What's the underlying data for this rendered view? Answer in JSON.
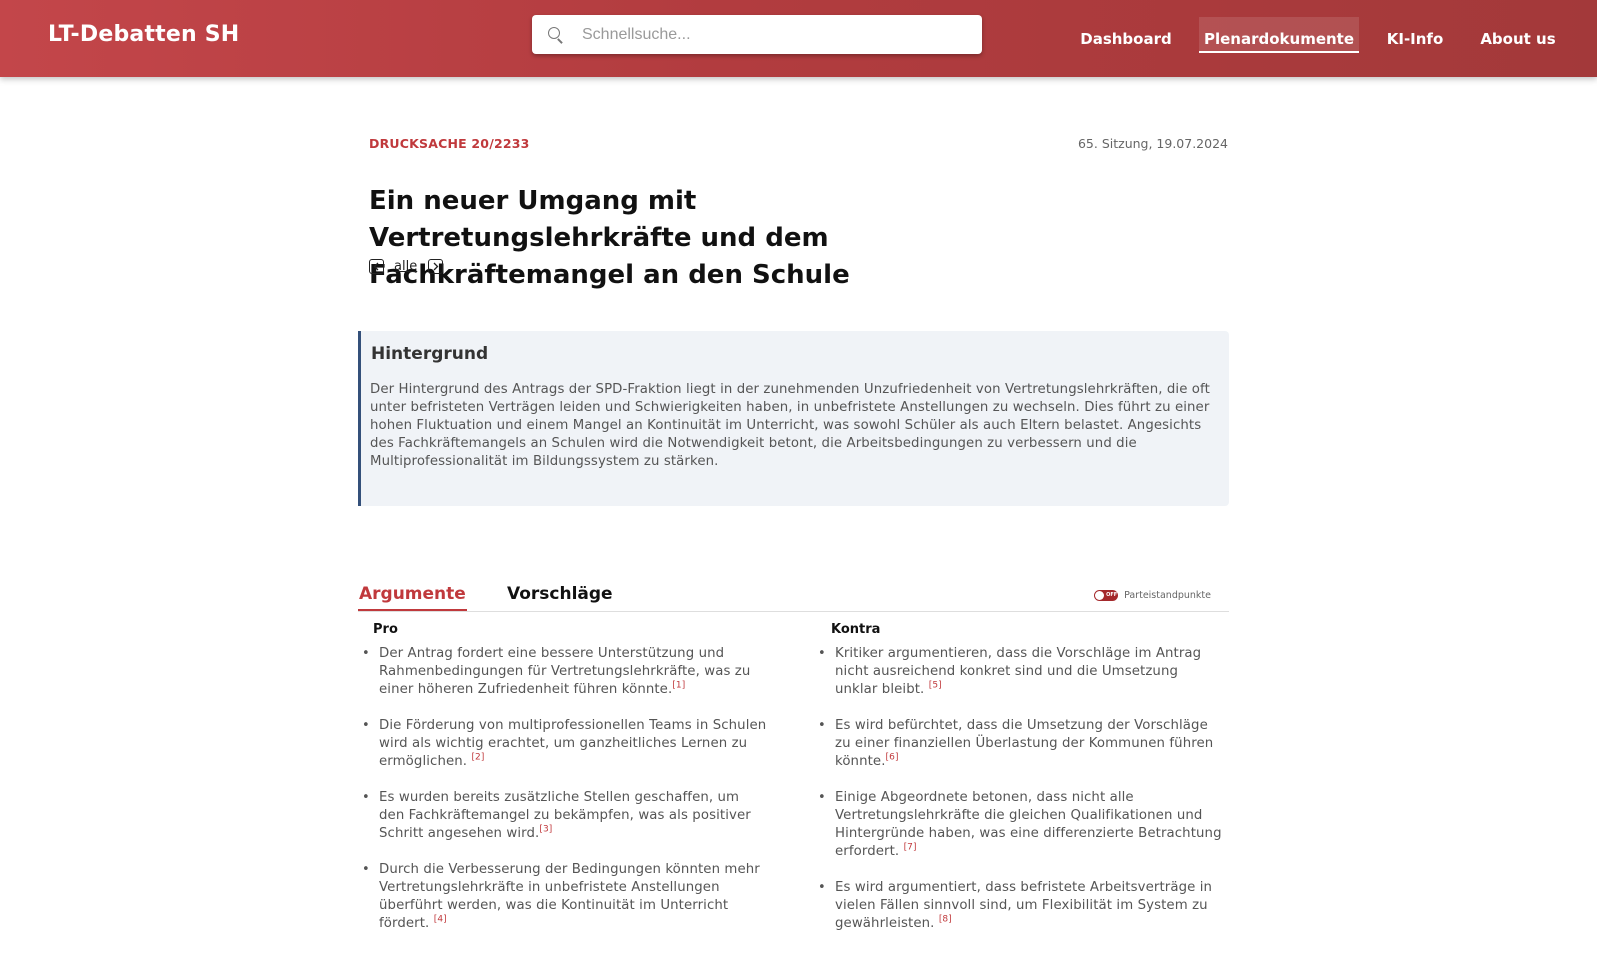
{
  "header": {
    "brand": "LT-Debatten SH",
    "search_placeholder": "Schnellsuche...",
    "nav": [
      {
        "label": "Dashboard"
      },
      {
        "label": "Plenardokumente"
      },
      {
        "label": "KI-Info"
      },
      {
        "label": "About us"
      }
    ],
    "active_nav": "Plenardokumente"
  },
  "document": {
    "number": "DRUCKSACHE 20/2233",
    "session": "65. Sitzung, 19.07.2024",
    "title": "Ein neuer Umgang mit Vertretungslehrkräfte und dem Fachkräftemangel an den Schule",
    "pager": {
      "prev": "<",
      "all": "alle",
      "next": ">"
    }
  },
  "background": {
    "title": "Hintergrund",
    "text": "Der Hintergrund des Antrags der SPD-Fraktion liegt in der zunehmenden  Unzufriedenheit von Vertretungslehrkräften, die oft unter befristeten  Verträgen leiden und Schwierigkeiten haben, in unbefristete Anstellungen  zu wechseln. Dies führt zu einer hohen Fluktuation und einem Mangel an  Kontinuität im Unterricht, was sowohl Schüler als auch Eltern belastet. Angesichts des Fachkräftemangels an Schulen wird die Notwendigkeit  betont, die Arbeitsbedingungen zu verbessern und die  Multiprofessionalität im Bildungssystem zu stärken."
  },
  "tabs": {
    "items": [
      {
        "label": "Argumente"
      },
      {
        "label": "Vorschläge"
      }
    ],
    "active": "Argumente",
    "toggle_state": "OFF",
    "toggle_label": "Parteistandpunkte"
  },
  "arguments": {
    "pro_heading": "Pro",
    "contra_heading": "Kontra",
    "pro": [
      {
        "text": "Der Antrag fordert eine bessere Unterstützung und Rahmenbedingungen für  Vertretungslehrkräfte, was zu einer höheren Zufriedenheit führen könnte.",
        "ref": "[1]"
      },
      {
        "text": "Die Förderung von multiprofessionellen Teams in Schulen wird als wichtig erachtet, um ganzheitliches Lernen zu ermöglichen. ",
        "ref": "[2]"
      },
      {
        "text": "Es wurden bereits zusätzliche Stellen geschaffen, um den  Fachkräftemangel zu bekämpfen, was als positiver Schritt angesehen wird.",
        "ref": "[3]"
      },
      {
        "text": "Durch die Verbesserung der Bedingungen könnten mehr Vertretungslehrkräfte in unbefristete Anstellungen überführt werden, was  die Kontinuität im Unterricht fördert. ",
        "ref": "[4]"
      }
    ],
    "contra": [
      {
        "text": "Kritiker argumentieren, dass die Vorschläge im Antrag nicht ausreichend konkret sind und die Umsetzung unklar bleibt. ",
        "ref": "[5]"
      },
      {
        "text": "Es wird befürchtet, dass die Umsetzung der Vorschläge zu einer finanziellen Überlastung der Kommunen führen könnte.",
        "ref": "[6]"
      },
      {
        "text": "Einige Abgeordnete betonen, dass nicht alle Vertretungslehrkräfte die  gleichen Qualifikationen und Hintergründe haben, was eine differenzierte Betrachtung erfordert. ",
        "ref": "[7]"
      },
      {
        "text": "Es wird argumentiert, dass befristete Arbeitsverträge in vielen Fällen  sinnvoll sind, um Flexibilität im System zu gewährleisten. ",
        "ref": "[8]"
      }
    ]
  },
  "colors": {
    "header_red": "#b23c3f",
    "accent_red": "#c0393c",
    "panel_bg": "#f0f3f7",
    "panel_border": "#34507a"
  }
}
